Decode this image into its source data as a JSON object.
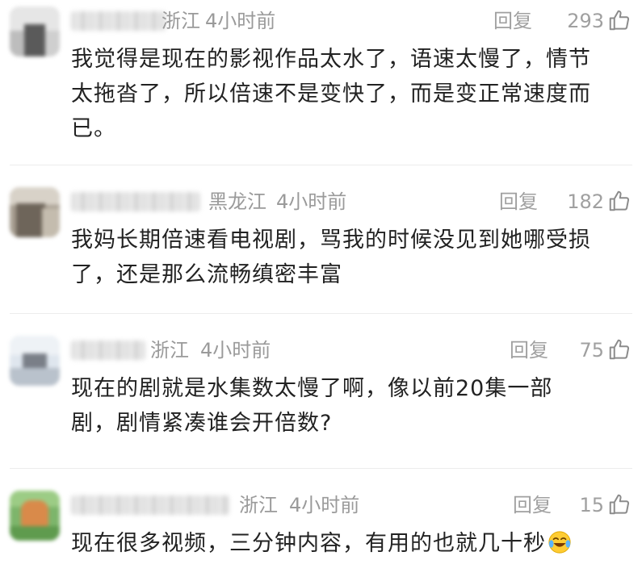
{
  "comments": [
    {
      "region": "浙江",
      "time": "4小时前",
      "reply_label": "回复",
      "likes": "293",
      "lines": [
        "我觉得是现在的影视作品太水了，语速太慢了，情节",
        "太拖沓了，所以倍速不是变快了，而是变正常速度而",
        "已。"
      ]
    },
    {
      "region": "黑龙江",
      "time": "4小时前",
      "reply_label": "回复",
      "likes": "182",
      "lines": [
        "我妈长期倍速看电视剧，骂我的时候没见到她哪受损",
        "了，还是那么流畅缜密丰富"
      ]
    },
    {
      "region": "浙江",
      "time": "4小时前",
      "reply_label": "回复",
      "likes": "75",
      "lines": [
        "现在的剧就是水集数太慢了啊，像以前20集一部",
        "剧，剧情紧凑谁会开倍数?"
      ]
    },
    {
      "region": "浙江",
      "time": "4小时前",
      "reply_label": "回复",
      "likes": "15",
      "lines": [
        "现在很多视频，三分钟内容，有用的也就几十秒"
      ],
      "emoji": "laughing-crying-emoji"
    }
  ],
  "colors": {
    "meta_gray": "#9a9a9a",
    "text": "#222222",
    "divider": "#ececec"
  },
  "icons": {
    "like": "thumbs-up-icon"
  }
}
